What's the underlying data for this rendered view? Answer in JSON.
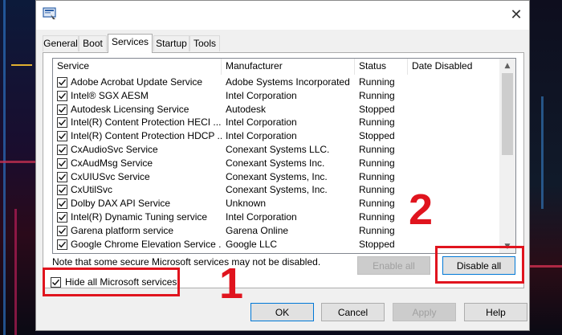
{
  "tabs": [
    {
      "label": "General"
    },
    {
      "label": "Boot"
    },
    {
      "label": "Services"
    },
    {
      "label": "Startup"
    },
    {
      "label": "Tools"
    }
  ],
  "columns": {
    "service": "Service",
    "manufacturer": "Manufacturer",
    "status": "Status",
    "date_disabled": "Date Disabled"
  },
  "services": [
    {
      "name": "Adobe Acrobat Update Service",
      "manufacturer": "Adobe Systems Incorporated",
      "status": "Running",
      "checked": true
    },
    {
      "name": "Intel® SGX AESM",
      "manufacturer": "Intel Corporation",
      "status": "Running",
      "checked": true
    },
    {
      "name": "Autodesk Licensing Service",
      "manufacturer": "Autodesk",
      "status": "Stopped",
      "checked": true
    },
    {
      "name": "Intel(R) Content Protection HECI ...",
      "manufacturer": "Intel Corporation",
      "status": "Running",
      "checked": true
    },
    {
      "name": "Intel(R) Content Protection HDCP ...",
      "manufacturer": "Intel Corporation",
      "status": "Stopped",
      "checked": true
    },
    {
      "name": "CxAudioSvc Service",
      "manufacturer": "Conexant Systems LLC.",
      "status": "Running",
      "checked": true
    },
    {
      "name": "CxAudMsg Service",
      "manufacturer": "Conexant Systems Inc.",
      "status": "Running",
      "checked": true
    },
    {
      "name": "CxUIUSvc Service",
      "manufacturer": "Conexant Systems, Inc.",
      "status": "Running",
      "checked": true
    },
    {
      "name": "CxUtilSvc",
      "manufacturer": "Conexant Systems, Inc.",
      "status": "Running",
      "checked": true
    },
    {
      "name": "Dolby DAX API Service",
      "manufacturer": "Unknown",
      "status": "Running",
      "checked": true
    },
    {
      "name": "Intel(R) Dynamic Tuning service",
      "manufacturer": "Intel Corporation",
      "status": "Running",
      "checked": true
    },
    {
      "name": "Garena platform service",
      "manufacturer": "Garena Online",
      "status": "Running",
      "checked": true
    },
    {
      "name": "Google Chrome Elevation Service ...",
      "manufacturer": "Google LLC",
      "status": "Stopped",
      "checked": true
    }
  ],
  "note": "Note that some secure Microsoft services may not be disabled.",
  "buttons": {
    "enable_all": "Enable all",
    "disable_all": "Disable all",
    "ok": "OK",
    "cancel": "Cancel",
    "apply": "Apply",
    "help": "Help"
  },
  "hide_ms": {
    "label": "Hide all Microsoft services",
    "checked": true
  },
  "annotations": {
    "step1": "1",
    "step2": "2"
  },
  "colors": {
    "annotation": "#e0141e",
    "focus": "#0078d7"
  }
}
